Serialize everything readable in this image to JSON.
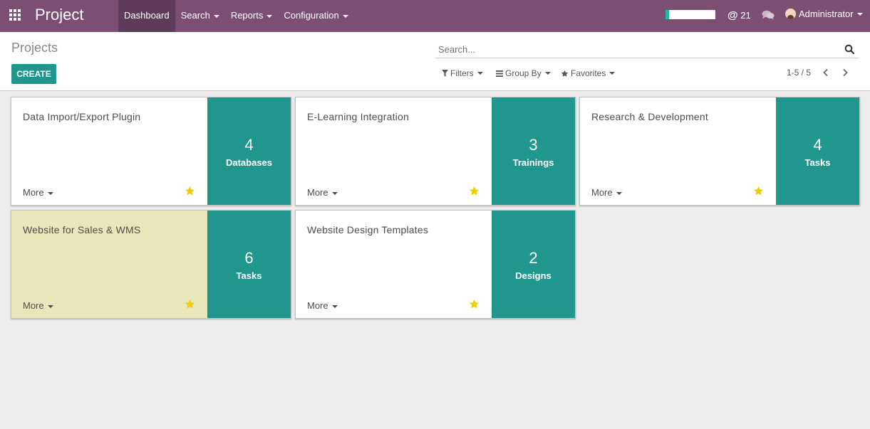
{
  "navbar": {
    "brand": "Project",
    "menu": [
      {
        "label": "Dashboard",
        "active": true,
        "dropdown": false
      },
      {
        "label": "Search",
        "active": false,
        "dropdown": true
      },
      {
        "label": "Reports",
        "active": false,
        "dropdown": true
      },
      {
        "label": "Configuration",
        "active": false,
        "dropdown": true
      }
    ],
    "progress_fraction": 0.07,
    "mentions_count": "21",
    "mentions_symbol": "@",
    "user_name": "Administrator"
  },
  "control_panel": {
    "breadcrumb": "Projects",
    "create_label": "CREATE",
    "search_placeholder": "Search...",
    "filters_label": "Filters",
    "group_by_label": "Group By",
    "favorites_label": "Favorites",
    "pager_text": "1-5 / 5"
  },
  "projects": [
    {
      "name": "Data Import/Export Plugin",
      "count": "4",
      "unit": "Databases",
      "more": "More",
      "favorite": true,
      "color": "white"
    },
    {
      "name": "E-Learning Integration",
      "count": "3",
      "unit": "Trainings",
      "more": "More",
      "favorite": true,
      "color": "white"
    },
    {
      "name": "Research & Development",
      "count": "4",
      "unit": "Tasks",
      "more": "More",
      "favorite": true,
      "color": "white"
    },
    {
      "name": "Website for Sales & WMS",
      "count": "6",
      "unit": "Tasks",
      "more": "More",
      "favorite": true,
      "color": "yellow"
    },
    {
      "name": "Website Design Templates",
      "count": "2",
      "unit": "Designs",
      "more": "More",
      "favorite": true,
      "color": "white"
    }
  ],
  "colors": {
    "navbar": "#7c4f72",
    "accent": "#21968f",
    "star": "#f3cc00",
    "yellow_card": "#e9e6bb"
  }
}
